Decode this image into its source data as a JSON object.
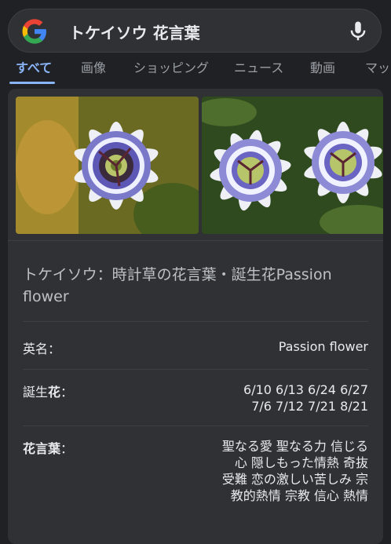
{
  "search": {
    "query": "トケイソウ 花言葉"
  },
  "tabs": [
    {
      "label": "すべて",
      "active": true
    },
    {
      "label": "画像"
    },
    {
      "label": "ショッピング"
    },
    {
      "label": "ニュース"
    },
    {
      "label": "動画"
    },
    {
      "label": "マッ"
    }
  ],
  "result": {
    "title": "トケイソウ：時計草の花言葉・誕生花Passion flower",
    "rows": [
      {
        "label": "英名：",
        "value": "Passion flower"
      },
      {
        "label_prefix": "誕生",
        "label_bold": "花",
        "label_suffix": "：",
        "value": "6/10 6/13 6/24 6/27 7/6 7/12 7/21 8/21"
      },
      {
        "label_bold": "花言葉",
        "label_suffix": "：",
        "value": "聖なる愛 聖なる力 信じる心 隠しもった情熱 奇抜 受難 恋の激しい苦しみ 宗教的熱情 宗教 信心 熱情"
      }
    ]
  },
  "icons": {
    "logo": "google-g-logo",
    "mic": "microphone-icon"
  },
  "colors": {
    "background": "#202124",
    "search_box": "#303134",
    "card": "#303134",
    "accent": "#8ab4f8",
    "muted_text": "#9aa0a6"
  }
}
